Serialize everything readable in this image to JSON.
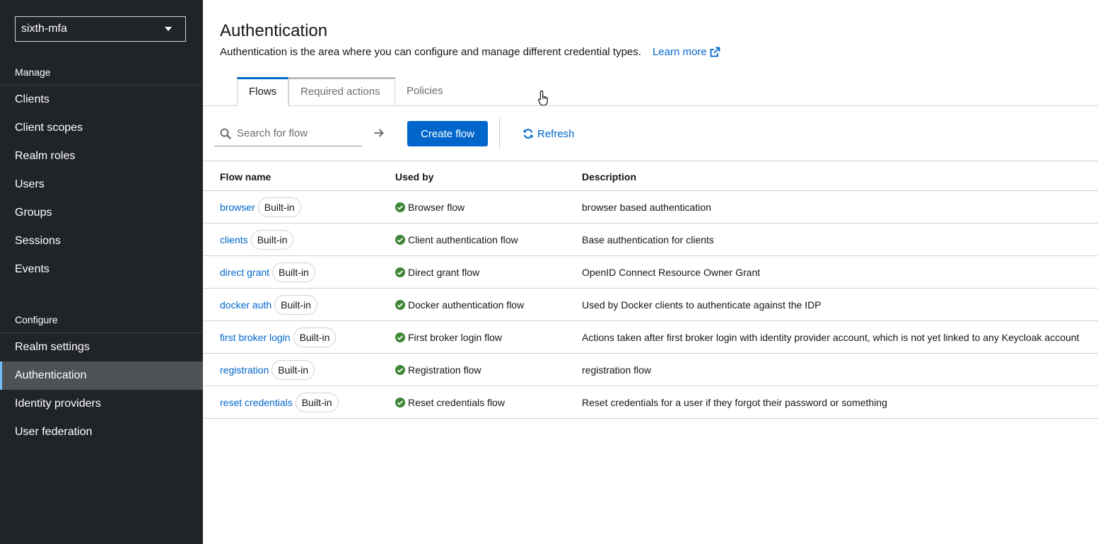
{
  "sidebar": {
    "realm": "sixth-mfa",
    "sections": [
      {
        "title": "Manage",
        "items": [
          {
            "label": "Clients"
          },
          {
            "label": "Client scopes"
          },
          {
            "label": "Realm roles"
          },
          {
            "label": "Users"
          },
          {
            "label": "Groups"
          },
          {
            "label": "Sessions"
          },
          {
            "label": "Events"
          }
        ]
      },
      {
        "title": "Configure",
        "items": [
          {
            "label": "Realm settings"
          },
          {
            "label": "Authentication",
            "active": true
          },
          {
            "label": "Identity providers"
          },
          {
            "label": "User federation"
          }
        ]
      }
    ]
  },
  "page": {
    "title": "Authentication",
    "description": "Authentication is the area where you can configure and manage different credential types.",
    "learn_more": "Learn more"
  },
  "tabs": [
    {
      "label": "Flows",
      "active": true
    },
    {
      "label": "Required actions"
    },
    {
      "label": "Policies"
    }
  ],
  "toolbar": {
    "search_placeholder": "Search for flow",
    "create_label": "Create flow",
    "refresh_label": "Refresh"
  },
  "table": {
    "columns": [
      "Flow name",
      "Used by",
      "Description"
    ],
    "badge_label": "Built-in",
    "rows": [
      {
        "name": "browser",
        "used_by": "Browser flow",
        "description": "browser based authentication"
      },
      {
        "name": "clients",
        "used_by": "Client authentication flow",
        "description": "Base authentication for clients"
      },
      {
        "name": "direct grant",
        "used_by": "Direct grant flow",
        "description": "OpenID Connect Resource Owner Grant"
      },
      {
        "name": "docker auth",
        "used_by": "Docker authentication flow",
        "description": "Used by Docker clients to authenticate against the IDP"
      },
      {
        "name": "first broker login",
        "used_by": "First broker login flow",
        "description": "Actions taken after first broker login with identity provider account, which is not yet linked to any Keycloak account"
      },
      {
        "name": "registration",
        "used_by": "Registration flow",
        "description": "registration flow"
      },
      {
        "name": "reset credentials",
        "used_by": "Reset credentials flow",
        "description": "Reset credentials for a user if they forgot their password or something"
      }
    ]
  },
  "colors": {
    "sidebar_bg": "#212427",
    "accent": "#0066cc",
    "success": "#3e8635"
  },
  "icons": [
    "caret-down-icon",
    "external-link-icon",
    "search-icon",
    "arrow-right-icon",
    "refresh-icon",
    "check-circle-icon",
    "hand-pointer-icon"
  ]
}
